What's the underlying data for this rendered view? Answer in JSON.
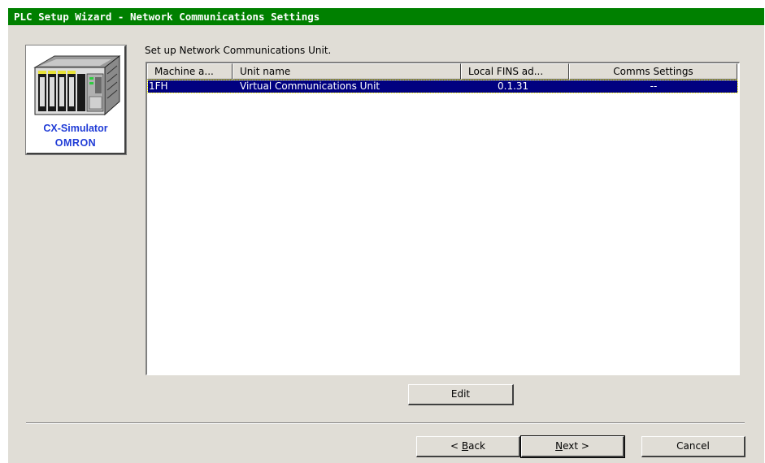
{
  "window": {
    "title": "PLC Setup Wizard - Network Communications Settings"
  },
  "logo": {
    "product": "CX-Simulator",
    "brand": "OMRON"
  },
  "main": {
    "instruction": "Set up Network Communications Unit."
  },
  "table": {
    "columns": [
      "Machine a...",
      "Unit name",
      "Local FINS ad...",
      "Comms Settings"
    ],
    "rows": [
      {
        "machine_address": "1FH",
        "unit_name": "Virtual Communications Unit",
        "local_fins_address": "0.1.31",
        "comms_settings": "--",
        "selected": true
      }
    ]
  },
  "buttons": {
    "edit": "Edit",
    "back_pre": "< ",
    "back_key": "B",
    "back_post": "ack",
    "next_key": "N",
    "next_post": "ext >",
    "cancel": "Cancel"
  },
  "colors": {
    "titlebar": "#008000",
    "selection": "#000080",
    "brand_blue": "#1f3bd6",
    "dialog_bg": "#e0ddd6"
  }
}
